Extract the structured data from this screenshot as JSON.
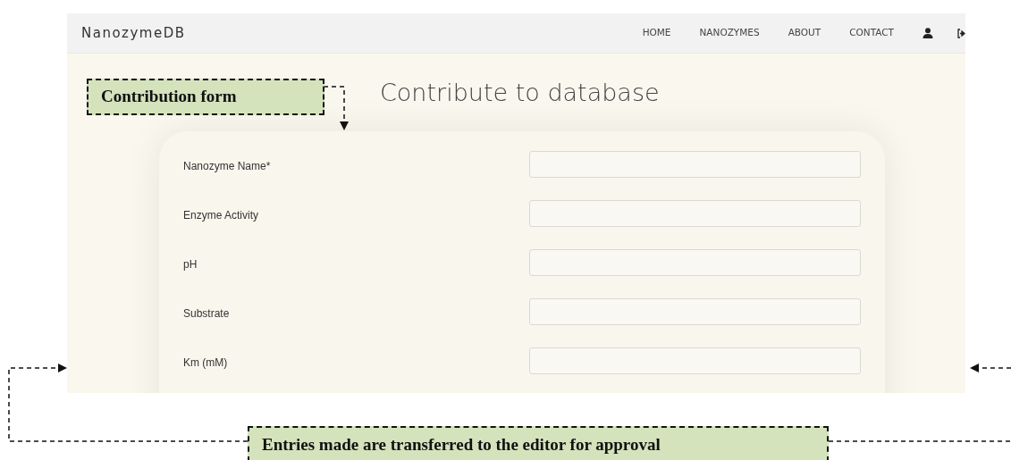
{
  "screen": {
    "brand": "NanozymeDB",
    "nav": [
      {
        "label": "HOME"
      },
      {
        "label": "NANOZYMES"
      },
      {
        "label": "ABOUT"
      },
      {
        "label": "CONTACT"
      }
    ],
    "heading": "Contribute to database",
    "fields": [
      {
        "label": "Nanozyme Name*"
      },
      {
        "label": "Enzyme Activity"
      },
      {
        "label": "pH"
      },
      {
        "label": "Substrate"
      },
      {
        "label": "Km (mM)"
      }
    ]
  },
  "annotations": [
    {
      "text": "Contribution form"
    },
    {
      "text": "Entries made are transferred to the editor for approval"
    }
  ]
}
